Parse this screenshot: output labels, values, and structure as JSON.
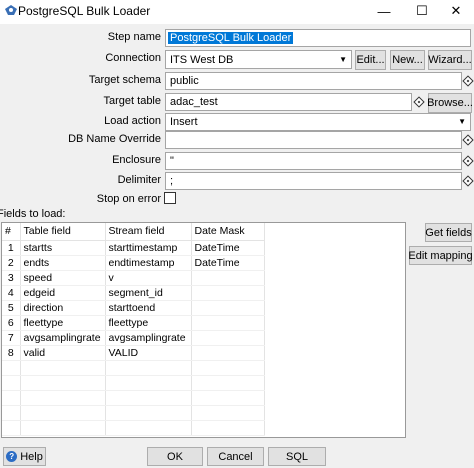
{
  "window": {
    "title": "PostgreSQL Bulk Loader",
    "minimize_glyph": "—",
    "maximize_glyph": "☐",
    "close_glyph": "✕"
  },
  "form": {
    "step_name_label": "Step name",
    "step_name_value": "PostgreSQL Bulk Loader",
    "connection_label": "Connection",
    "connection_value": "ITS West DB",
    "edit_button": "Edit...",
    "new_button": "New...",
    "wizard_button": "Wizard...",
    "target_schema_label": "Target schema",
    "target_schema_value": "public",
    "target_table_label": "Target table",
    "target_table_value": "adac_test",
    "browse_button": "Browse...",
    "load_action_label": "Load action",
    "load_action_value": "Insert",
    "db_name_override_label": "DB Name Override",
    "db_name_override_value": "",
    "enclosure_label": "Enclosure",
    "enclosure_value": "\"",
    "delimiter_label": "Delimiter",
    "delimiter_value": ";",
    "stop_on_error_label": "Stop on error",
    "stop_on_error_checked": false
  },
  "fields": {
    "section_label": "Fields to load:",
    "columns": [
      "#",
      "Table field",
      "Stream field",
      "Date Mask"
    ],
    "rows": [
      {
        "num": "1",
        "table_field": "startts",
        "stream_field": "starttimestamp",
        "date_mask": "DateTime"
      },
      {
        "num": "2",
        "table_field": "endts",
        "stream_field": "endtimestamp",
        "date_mask": "DateTime"
      },
      {
        "num": "3",
        "table_field": "speed",
        "stream_field": "v",
        "date_mask": ""
      },
      {
        "num": "4",
        "table_field": "edgeid",
        "stream_field": "segment_id",
        "date_mask": ""
      },
      {
        "num": "5",
        "table_field": "direction",
        "stream_field": "starttoend",
        "date_mask": ""
      },
      {
        "num": "6",
        "table_field": "fleettype",
        "stream_field": "fleettype",
        "date_mask": ""
      },
      {
        "num": "7",
        "table_field": "avgsamplingrate",
        "stream_field": "avgsamplingrate",
        "date_mask": ""
      },
      {
        "num": "8",
        "table_field": "valid",
        "stream_field": "VALID",
        "date_mask": ""
      }
    ],
    "get_fields_button": "Get fields",
    "edit_mapping_button": "Edit mapping"
  },
  "footer": {
    "help_button": "Help",
    "ok_button": "OK",
    "cancel_button": "Cancel",
    "sql_button": "SQL"
  }
}
